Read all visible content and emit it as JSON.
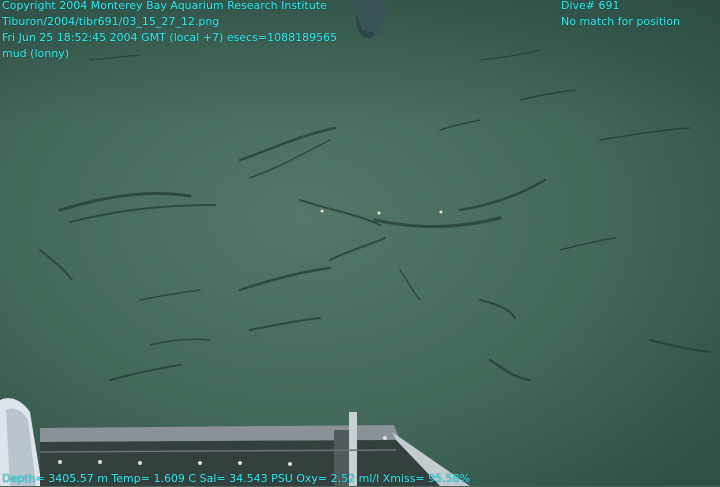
{
  "overlay": {
    "copyright": "Copyright 2004 Monterey Bay Aquarium Research Institute",
    "file_path": "Tiburon/2004/tibr691/03_15_27_12.png",
    "timestamp": "Fri Jun 25 18:52:45 2004 GMT (local +7)  esecs=1088189565",
    "annotation": "mud (lonny)",
    "dive": "Dive# 691",
    "position_status": "No match for position",
    "telemetry": "Depth= 3405.57 m  Temp= 1.609 C  Sal= 34.543 PSU  Oxy= 2.52 ml/l  Xmiss= 95.58%"
  },
  "colors": {
    "overlay_text": "#33eaf0",
    "seafloor": "#3f6658"
  }
}
